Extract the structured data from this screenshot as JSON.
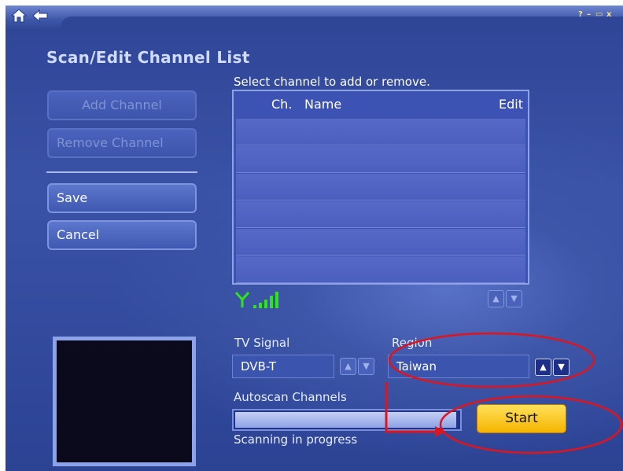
{
  "window": {
    "home_icon": "home-icon",
    "back_icon": "back-arrow-icon",
    "controls": [
      "?",
      "–",
      "▭",
      "x"
    ]
  },
  "page": {
    "title": "Scan/Edit Channel List",
    "instruction": "Select channel to add or remove."
  },
  "actions": {
    "add_channel": "Add Channel",
    "remove_channel": "Remove Channel",
    "save": "Save",
    "cancel": "Cancel"
  },
  "channel_list": {
    "columns": [
      "Ch.",
      "Name",
      "Edit"
    ],
    "rows": [],
    "visible_empty_rows": 6
  },
  "signal_strength": {
    "antenna_icon": "antenna-icon",
    "bars_lit": 4,
    "bars_total": 4,
    "color": "#2fe51a"
  },
  "tv_signal": {
    "label": "TV Signal",
    "value": "DVB-T"
  },
  "region": {
    "label": "Region",
    "value": "Taiwan"
  },
  "autoscan": {
    "label": "Autoscan Channels",
    "progress": 0.99,
    "status": "Scanning in progress",
    "start_label": "Start"
  },
  "annotations": {
    "color": "#e0141c"
  }
}
